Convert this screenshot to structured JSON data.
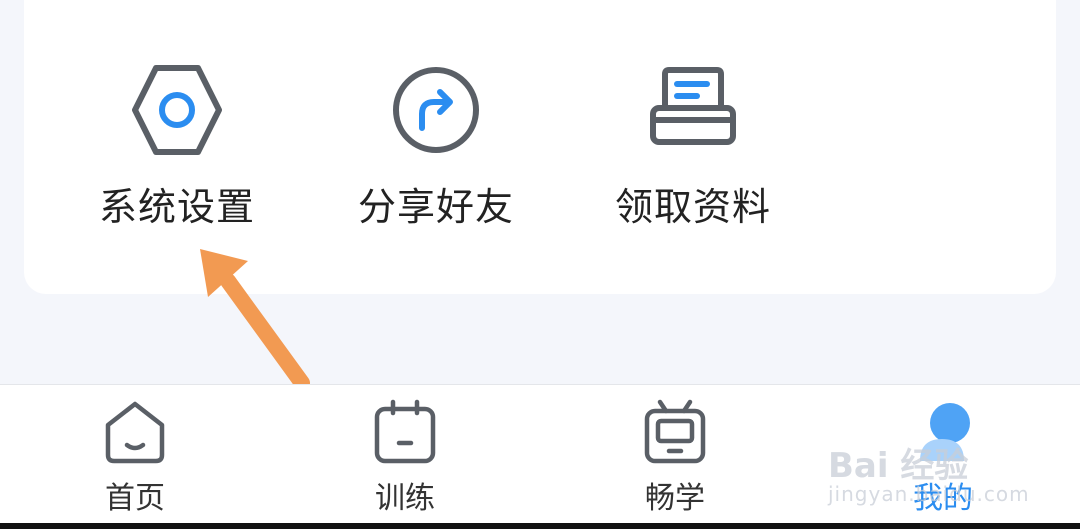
{
  "grid": {
    "items": [
      {
        "label": "系统设置",
        "icon": "settings-hex-icon"
      },
      {
        "label": "分享好友",
        "icon": "share-icon"
      },
      {
        "label": "领取资料",
        "icon": "materials-tray-icon"
      }
    ]
  },
  "tabbar": {
    "tabs": [
      {
        "label": "首页",
        "icon": "home-icon",
        "active": false
      },
      {
        "label": "训练",
        "icon": "training-icon",
        "active": false
      },
      {
        "label": "畅学",
        "icon": "tv-learn-icon",
        "active": false
      },
      {
        "label": "我的",
        "icon": "profile-icon",
        "active": true
      }
    ]
  },
  "watermark": {
    "main": "Bai 经验",
    "sub": "jingyan.baidu.com"
  },
  "colors": {
    "accent": "#2b8df0",
    "icon_stroke": "#5a5f66",
    "annotation_arrow": "#f29a52",
    "background": "#f4f6fb"
  }
}
